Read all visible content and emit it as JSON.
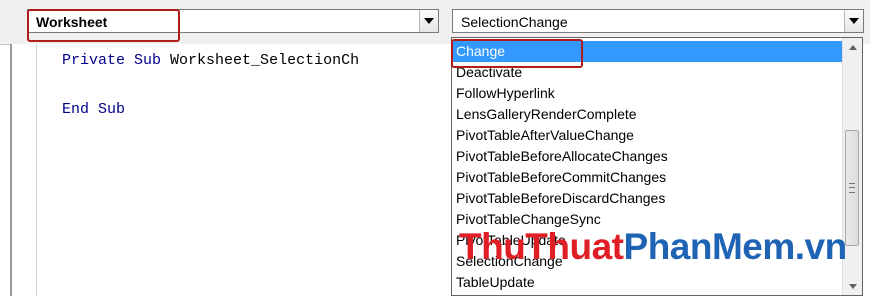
{
  "object_combo": {
    "value": "Worksheet"
  },
  "procedure_combo": {
    "value": "SelectionChange"
  },
  "code": {
    "line1_keywords": "Private Sub",
    "line1_name": "Worksheet_SelectionCh",
    "line2": "End Sub"
  },
  "dropdown": {
    "selected_index": 0,
    "items": [
      "Change",
      "Deactivate",
      "FollowHyperlink",
      "LensGalleryRenderComplete",
      "PivotTableAfterValueChange",
      "PivotTableBeforeAllocateChanges",
      "PivotTableBeforeCommitChanges",
      "PivotTableBeforeDiscardChanges",
      "PivotTableChangeSync",
      "PivotTableUpdate",
      "SelectionChange",
      "TableUpdate"
    ]
  },
  "watermark": {
    "part1": "ThuThuat",
    "part2": "PhanMem.vn"
  },
  "colors": {
    "selection": "#3399ff",
    "highlight_box": "#b01c1c",
    "keyword": "#00008b"
  }
}
